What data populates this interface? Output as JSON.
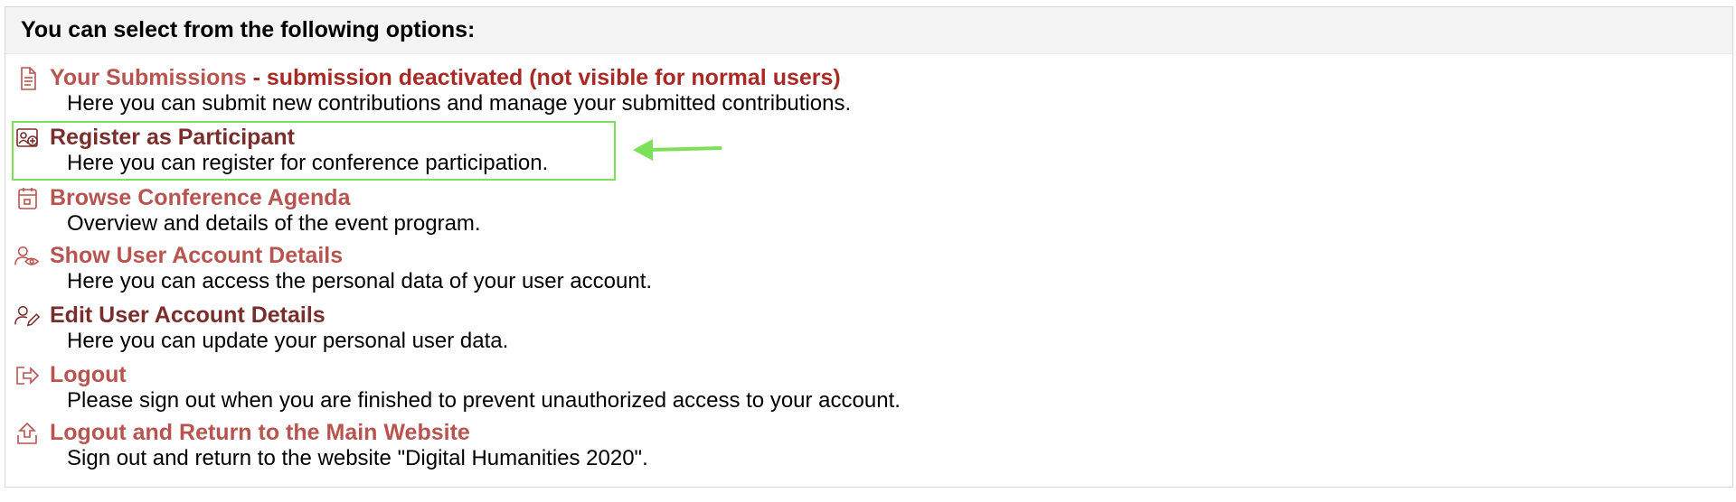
{
  "header": {
    "title": "You can select from the following options:"
  },
  "options": [
    {
      "icon": "document-icon",
      "title": "Your Submissions",
      "note": " - submission deactivated (not visible for normal users)",
      "description": "Here you can submit new contributions and manage your submitted contributions."
    },
    {
      "icon": "id-card-add-icon",
      "title": "Register as Participant",
      "description": "Here you can register for conference participation."
    },
    {
      "icon": "calendar-icon",
      "title": "Browse Conference Agenda",
      "description": "Overview and details of the event program."
    },
    {
      "icon": "user-eye-icon",
      "title": "Show User Account Details",
      "description": "Here you can access the personal data of your user account."
    },
    {
      "icon": "user-edit-icon",
      "title": "Edit User Account Details",
      "description": "Here you can update your personal user data."
    },
    {
      "icon": "logout-icon",
      "title": "Logout",
      "description": "Please sign out when you are finished to prevent unauthorized access to your account."
    },
    {
      "icon": "upload-exit-icon",
      "title": "Logout and Return to the Main Website",
      "description": "Sign out and return to the website \"Digital Humanities 2020\"."
    }
  ],
  "colors": {
    "link": "#b85450",
    "visited_link": "#7a2e2c",
    "warning_note": "#a82a24",
    "annotation": "#7de05a"
  }
}
